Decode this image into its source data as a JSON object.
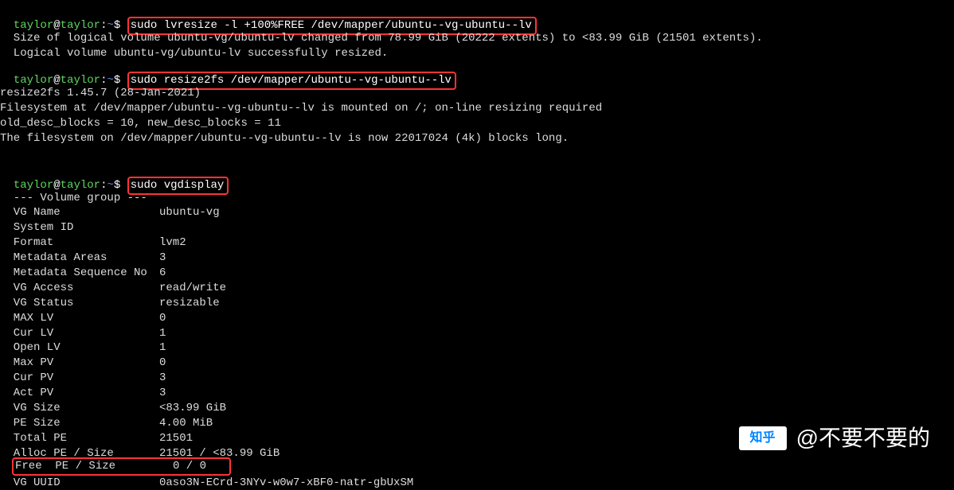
{
  "prompt": {
    "user": "taylor",
    "host": "taylor",
    "path": "~",
    "dollar": "$"
  },
  "cmd1": "sudo lvresize -l +100%FREE /dev/mapper/ubuntu--vg-ubuntu--lv",
  "out1_l1": "  Size of logical volume ubuntu-vg/ubuntu-lv changed from 78.99 GiB (20222 extents) to <83.99 GiB (21501 extents).",
  "out1_l2": "  Logical volume ubuntu-vg/ubuntu-lv successfully resized.",
  "cmd2": "sudo resize2fs /dev/mapper/ubuntu--vg-ubuntu--lv",
  "out2_l1": "resize2fs 1.45.7 (28-Jan-2021)",
  "out2_l2": "Filesystem at /dev/mapper/ubuntu--vg-ubuntu--lv is mounted on /; on-line resizing required",
  "out2_l3": "old_desc_blocks = 10, new_desc_blocks = 11",
  "out2_l4": "The filesystem on /dev/mapper/ubuntu--vg-ubuntu--lv is now 22017024 (4k) blocks long.",
  "cmd3": "sudo vgdisplay",
  "vg_header": "  --- Volume group ---",
  "vg": [
    {
      "k": "  VG Name",
      "v": "ubuntu-vg"
    },
    {
      "k": "  System ID",
      "v": ""
    },
    {
      "k": "  Format",
      "v": "lvm2"
    },
    {
      "k": "  Metadata Areas",
      "v": "3"
    },
    {
      "k": "  Metadata Sequence No",
      "v": "6"
    },
    {
      "k": "  VG Access",
      "v": "read/write"
    },
    {
      "k": "  VG Status",
      "v": "resizable"
    },
    {
      "k": "  MAX LV",
      "v": "0"
    },
    {
      "k": "  Cur LV",
      "v": "1"
    },
    {
      "k": "  Open LV",
      "v": "1"
    },
    {
      "k": "  Max PV",
      "v": "0"
    },
    {
      "k": "  Cur PV",
      "v": "3"
    },
    {
      "k": "  Act PV",
      "v": "3"
    },
    {
      "k": "  VG Size",
      "v": "<83.99 GiB"
    },
    {
      "k": "  PE Size",
      "v": "4.00 MiB"
    },
    {
      "k": "  Total PE",
      "v": "21501"
    },
    {
      "k": "  Alloc PE / Size",
      "v": "21501 / <83.99 GiB"
    },
    {
      "k": "  Free  PE / Size",
      "v": "0 / 0   "
    },
    {
      "k": "  VG UUID",
      "v": "0aso3N-ECrd-3NYv-w0w7-xBF0-natr-gbUxSM"
    }
  ],
  "watermark_text": "@不要不要的",
  "zhihu_label": "知乎"
}
